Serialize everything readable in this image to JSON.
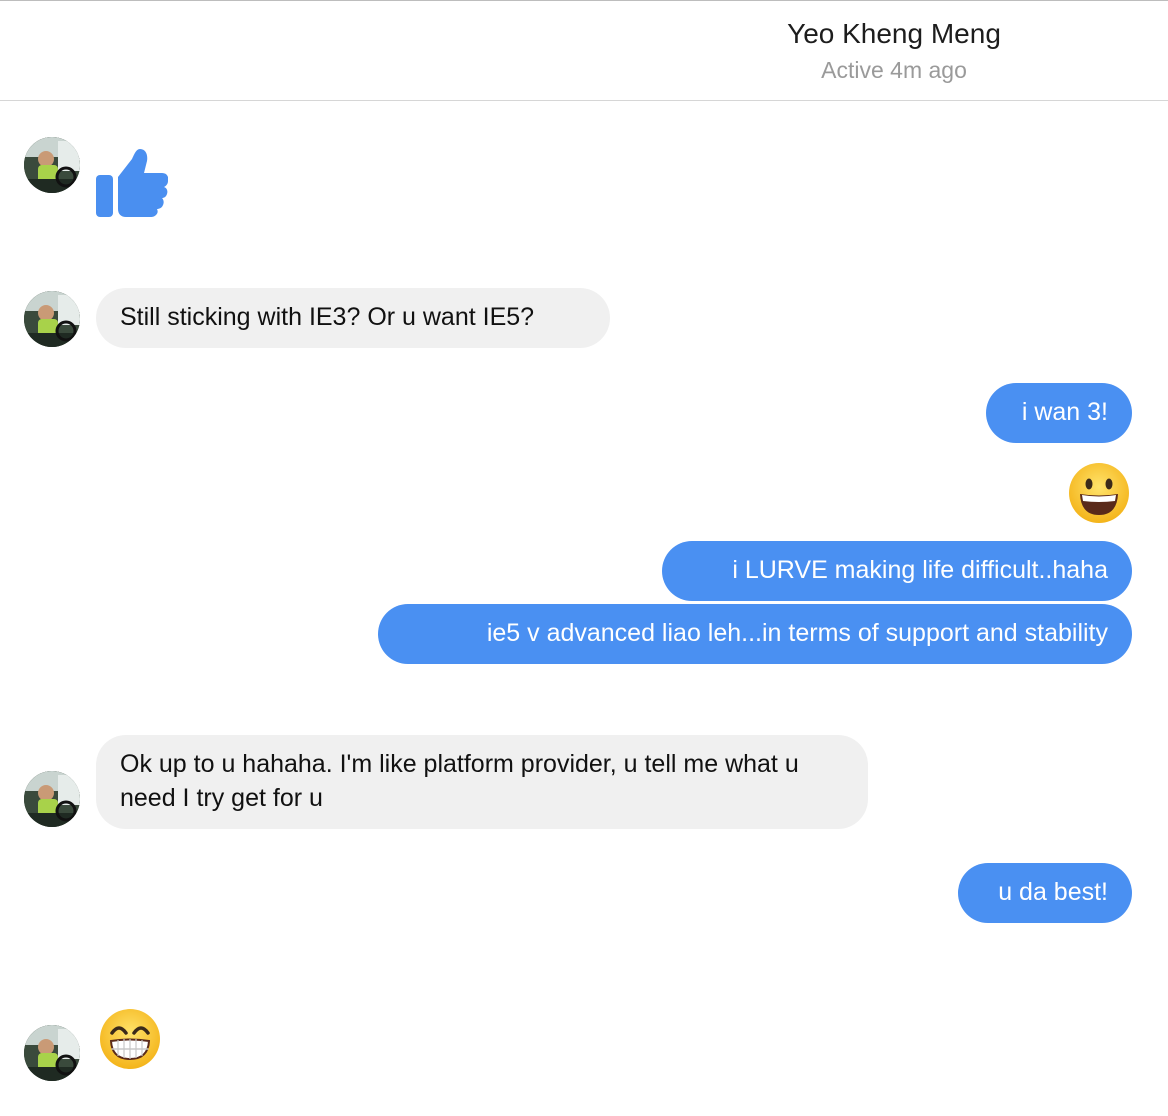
{
  "header": {
    "contact_name": "Yeo Kheng Meng",
    "status": "Active 4m ago"
  },
  "messages": [
    {
      "from": "them",
      "kind": "like-icon"
    },
    {
      "from": "them",
      "text": "Still sticking with IE3? Or u want IE5?"
    },
    {
      "from": "me",
      "text": "i wan 3!"
    },
    {
      "from": "me",
      "kind": "grinning-emoji"
    },
    {
      "from": "me",
      "text": "i LURVE making life difficult..haha"
    },
    {
      "from": "me",
      "text": "ie5 v advanced liao leh...in terms of support and stability"
    },
    {
      "from": "them",
      "text": "Ok up to u hahaha. I'm like platform provider, u tell me what u need I try get for u"
    },
    {
      "from": "me",
      "text": "u da best!"
    },
    {
      "from": "them",
      "kind": "beaming-grin-emoji"
    }
  ],
  "colors": {
    "outgoing_bubble": "#4a90f2",
    "incoming_bubble": "#f0f0f0",
    "like_blue": "#4a8ff0",
    "status_gray": "#9a9a9a"
  }
}
